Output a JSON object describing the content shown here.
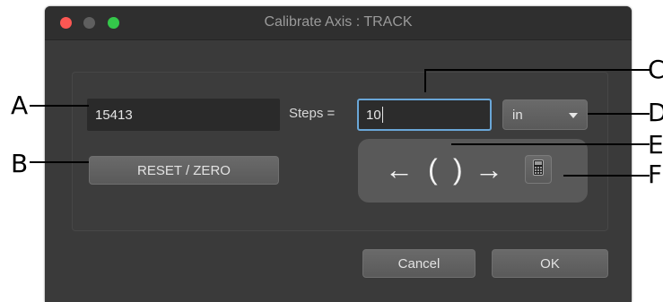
{
  "window": {
    "title": "Calibrate Axis : TRACK"
  },
  "colors": {
    "close": "#fc5753",
    "minimize": "#5f5f5f",
    "zoom": "#34c84a",
    "focus_ring": "#6aa7d8"
  },
  "position_field": {
    "value": "15413"
  },
  "steps": {
    "label": "Steps =",
    "value": "10"
  },
  "unit_select": {
    "value": "in",
    "icon": "chevron-down-icon"
  },
  "reset_button": {
    "label": "RESET / ZERO"
  },
  "jog": {
    "left_icon": "arrow-left-icon",
    "fine_left_icon": "paren-left-icon",
    "fine_right_icon": "paren-right-icon",
    "right_icon": "arrow-right-icon",
    "calculator_icon": "calculator-icon"
  },
  "buttons": {
    "cancel": "Cancel",
    "ok": "OK"
  },
  "callouts": [
    "A",
    "B",
    "C",
    "D",
    "E",
    "F"
  ]
}
